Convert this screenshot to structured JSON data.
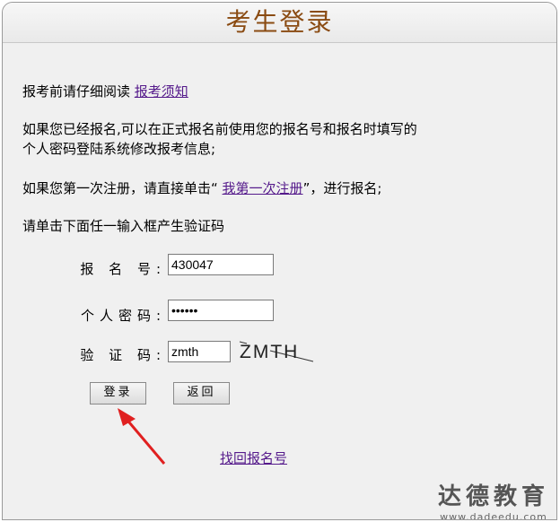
{
  "header": {
    "title": "考生登录"
  },
  "intro": {
    "notice_prefix": "报考前请仔细阅读 ",
    "notice_link": "报考须知",
    "registered_line1": "如果您已经报名,可以在正式报名前使用您的报名号和报名时填写的",
    "registered_line2": "个人密码登陆系统修改报考信息;",
    "first_time_prefix": "如果您第一次注册，请直接单击“ ",
    "first_time_link": "我第一次注册",
    "first_time_suffix": "”，进行报名;",
    "captcha_hint": "请单击下面任一输入框产生验证码"
  },
  "form": {
    "reg_no_label": "报 名 号:",
    "reg_no_value": "430047",
    "password_label": "个人密码:",
    "password_value": "••••••",
    "captcha_label": "验 证 码:",
    "captcha_value": "zmth",
    "captcha_image_text": "ZMTH"
  },
  "buttons": {
    "login": "登录",
    "back": "返回"
  },
  "recover_link": "找回报名号",
  "watermark": {
    "main": "达德教育",
    "url": "www.dadeedu.com"
  },
  "colors": {
    "title": "#8a4b12",
    "link": "#551a8b",
    "arrow": "#e02020"
  }
}
